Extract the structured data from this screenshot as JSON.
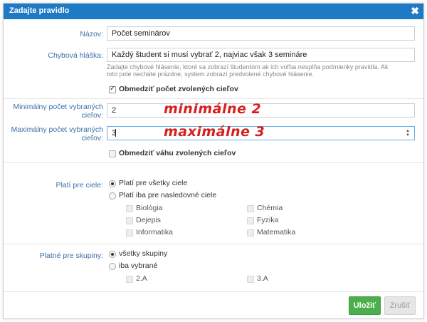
{
  "dialog": {
    "title": "Zadajte pravidlo",
    "close_icon": "close-icon"
  },
  "form": {
    "name_label": "Názov:",
    "name_value": "Počet seminárov",
    "error_label": "Chybová hláška:",
    "error_value": "Každý študent si musí vybrať 2, najviac však 3 semináre",
    "error_help_1": "Zadajte chybové hlásenie, ktoré sa zobrazí študentom ak ich voľba nesplňa podmienky pravidla. Ak",
    "error_help_2": "toto pole necháte prázdne, system zobrazí predvolené chybové hlásenie.",
    "limit_count_label": "Obmedziť počet zvolených cieľov",
    "limit_count_checked": true,
    "min_label_1": "Minimálny počet vybraných",
    "min_label_2": "cieľov:",
    "min_value": "2",
    "max_label_1": "Maximálny počet vybraných",
    "max_label_2": "cieľov:",
    "max_value": "3",
    "limit_weight_label": "Obmedziť váhu zvolených cieľov",
    "limit_weight_checked": false
  },
  "annotations": {
    "min_note": "minimálne 2",
    "max_note": "maximálne 3",
    "color": "#d61f1f"
  },
  "targets": {
    "label": "Platí pre ciele:",
    "option_all": "Platí pre všetky ciele",
    "option_some": "Platí iba pre nasledovné ciele",
    "selected": "all",
    "subjects": [
      "Biológia",
      "Chémia",
      "Dejepis",
      "Fyzika",
      "Informatika",
      "Matematika"
    ]
  },
  "groups": {
    "label": "Platné pre skupiny:",
    "option_all": "všetky skupiny",
    "option_some": "iba vybrané",
    "selected": "all",
    "items": [
      "2.A",
      "3.A"
    ]
  },
  "buttons": {
    "save": "Uložiť",
    "cancel": "Zrušiť",
    "save_color": "#4cae4c"
  },
  "colors": {
    "titlebar": "#1f7ac6",
    "label": "#3d6fa8"
  }
}
